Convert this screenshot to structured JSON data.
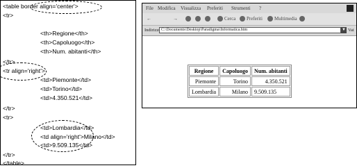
{
  "code": {
    "lines": [
      "<table border align='center'>",
      "<tr>",
      "<th>Regione</th>",
      "<th>Capoluogo</th>",
      "<th>Num. abitanti</th>",
      "</tr>",
      "<tr align='right'>",
      "<td>Piemonte</td>",
      "<td>Torino</td>",
      "<td>4.350.521</td>",
      "</tr>",
      "<tr>",
      "<td>Lombardia</td>",
      "<td align='right'>Milano</td>",
      "<td>9.509.135</td>",
      "</tr>",
      "</table>"
    ]
  },
  "browser": {
    "menu": [
      "File",
      "Modifica",
      "Visualizza",
      "Preferiti",
      "Strumenti",
      "?"
    ],
    "toolbar": [
      "←",
      "→",
      "Cerca",
      "Preferiti",
      "Multimedia"
    ],
    "address_label": "Indirizzo",
    "address_value": "C:\\Documents\\Desktop\\Paradigma\\Informatica.htm",
    "address_go": "Vai"
  },
  "table": {
    "headers": [
      "Regione",
      "Capoluogo",
      "Num. abitanti"
    ],
    "rows": [
      [
        "Piemonte",
        "Torino",
        "4.350.521"
      ],
      [
        "Lombardia",
        "Milano",
        "9.509.135"
      ]
    ]
  }
}
